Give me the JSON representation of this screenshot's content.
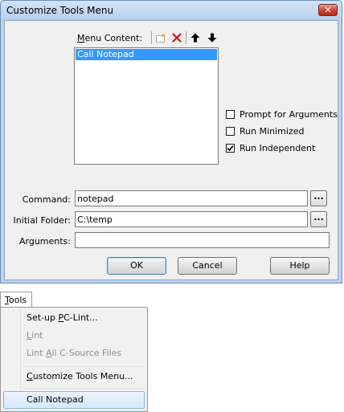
{
  "dialog": {
    "title": "Customize Tools Menu",
    "close_glyph": "✕",
    "menu_content_label_prefix": "M",
    "menu_content_label_rest": "enu Content:",
    "toolbar_icons": [
      "new-item-icon",
      "delete-icon",
      "move-up-icon",
      "move-down-icon"
    ],
    "list_items": [
      "Call Notepad"
    ],
    "checkboxes": [
      {
        "label": "Prompt for  Arguments",
        "checked": false
      },
      {
        "label": "Run Minimized",
        "checked": false
      },
      {
        "label": "Run Independent",
        "checked": true
      }
    ],
    "fields": {
      "command_label": "Command:",
      "command_value": "notepad",
      "folder_label": "Initial Folder:",
      "folder_value": "C:\\temp",
      "arguments_label": "Arguments:",
      "arguments_value": "",
      "browse_label": "..."
    },
    "buttons": {
      "ok": "OK",
      "cancel": "Cancel",
      "help": "Help"
    }
  },
  "tools_menu": {
    "tab_prefix": "T",
    "tab_rest": "ools",
    "items": [
      {
        "pre": "Set-up ",
        "acc": "P",
        "post": "C-Lint...",
        "disabled": false
      },
      {
        "pre": "",
        "acc": "L",
        "post": "int",
        "disabled": true
      },
      {
        "pre": "Lint ",
        "acc": "A",
        "post": "ll C-Source Files",
        "disabled": true
      },
      {
        "pre": "",
        "acc": "C",
        "post": "ustomize Tools Menu...",
        "disabled": false
      }
    ],
    "highlighted_item": "Call Notepad"
  },
  "colors": {
    "selection": "#3399ff",
    "title_bar": "#bcd2ee",
    "close_button": "#c7432c",
    "menu_highlight": "#d6e8fb"
  }
}
